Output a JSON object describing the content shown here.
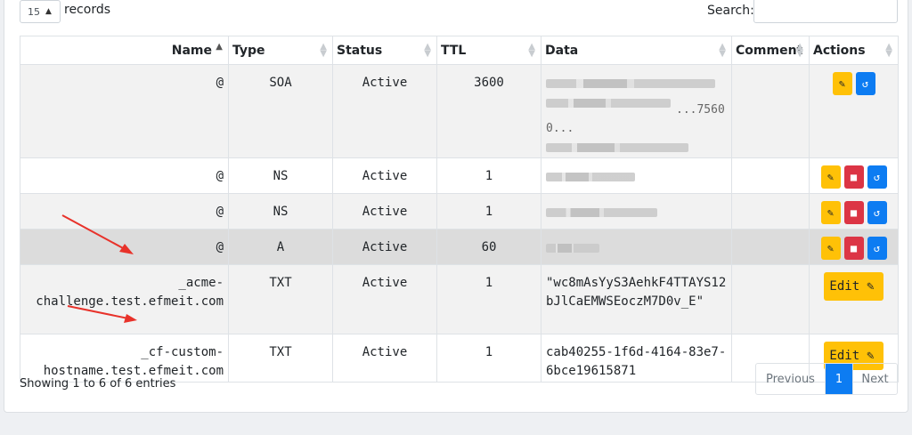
{
  "length_menu": {
    "value": "15",
    "label": "records"
  },
  "search": {
    "label": "Search:",
    "value": ""
  },
  "table": {
    "headers": [
      "Name",
      "Type",
      "Status",
      "TTL",
      "Data",
      "Comment",
      "Actions"
    ],
    "rows": [
      {
        "name": "@",
        "type": "SOA",
        "status": "Active",
        "ttl": "3600",
        "data_visible": "...7560 0...",
        "comment": ""
      },
      {
        "name": "@",
        "type": "NS",
        "status": "Active",
        "ttl": "1",
        "data_visible": "",
        "comment": ""
      },
      {
        "name": "@",
        "type": "NS",
        "status": "Active",
        "ttl": "1",
        "data_visible": "",
        "comment": ""
      },
      {
        "name": "@",
        "type": "A",
        "status": "Active",
        "ttl": "60",
        "data_visible": "",
        "comment": ""
      },
      {
        "name": "_acme-challenge.test.efmeit.com",
        "type": "TXT",
        "status": "Active",
        "ttl": "1",
        "data": "\"wc8mAsYyS3AehkF4TTAYS12bJlCaEMWSEoczM7D0v_E\"",
        "comment": "",
        "edit_label": "Edit"
      },
      {
        "name": "_cf-custom-hostname.test.efmeit.com",
        "type": "TXT",
        "status": "Active",
        "ttl": "1",
        "data": "cab40255-1f6d-4164-83e7-6bce19615871",
        "comment": "",
        "edit_label": "Edit"
      }
    ]
  },
  "footer": {
    "info": "Showing 1 to 6 of 6 entries",
    "pagination": {
      "previous": "Previous",
      "current": "1",
      "next": "Next"
    }
  },
  "colors": {
    "warning": "#ffc107",
    "danger": "#dc3545",
    "primary": "#0d7cf2",
    "annotation": "#e8322a"
  },
  "icons": {
    "edit": "pencil-square-icon",
    "delete": "trash-icon",
    "history": "history-icon",
    "sort": "sort-arrows-icon"
  }
}
